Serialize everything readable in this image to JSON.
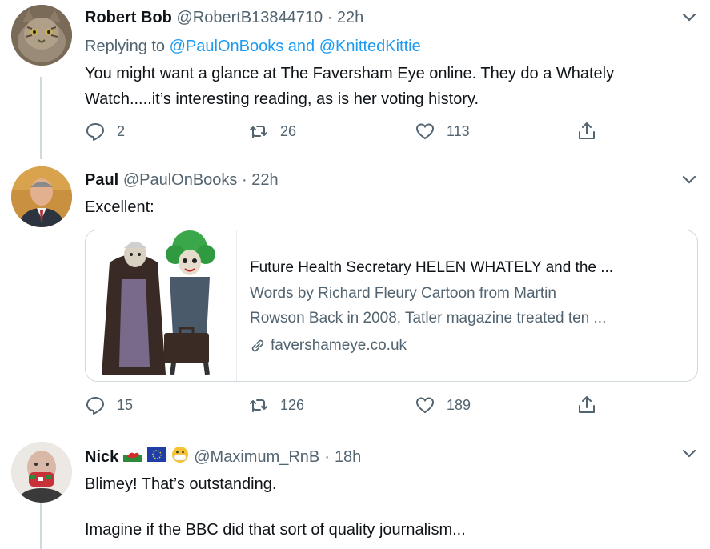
{
  "tweets": [
    {
      "name": "Robert Bob",
      "handle": "@RobertB13844710",
      "dot": "·",
      "time": "22h",
      "replying_prefix": "Replying to",
      "replying_to": "@PaulOnBooks and @KnittedKittie",
      "text_lines": [
        "You might want a glance at The Faversham Eye online. They do a Whately",
        "Watch.....it’s interesting reading, as is her voting history."
      ],
      "counts": {
        "replies": "2",
        "retweets": "26",
        "likes": "113"
      },
      "icons": {
        "reply": "reply-icon",
        "retweet": "retweet-icon",
        "like": "like-icon",
        "share": "share-icon",
        "more": "chevron-down-icon"
      }
    },
    {
      "name": "Paul",
      "handle": "@PaulOnBooks",
      "dot": "·",
      "time": "22h",
      "text_lines": [
        "Excellent:"
      ],
      "card": {
        "title": "Future Health Secretary HELEN WHATELY and the ...",
        "desc_lines": [
          "Words by Richard Fleury Cartoon from Martin",
          "Rowson Back in 2008, Tatler magazine treated ten ..."
        ],
        "domain": "favershameye.co.uk"
      },
      "counts": {
        "replies": "15",
        "retweets": "126",
        "likes": "189"
      }
    },
    {
      "name": "Nick",
      "handle": "@Maximum_RnB",
      "dot": "·",
      "time": "18h",
      "emojis": [
        "wales-flag-emoji",
        "eu-flag-emoji",
        "mask-face-emoji"
      ],
      "text_lines": [
        "Blimey! That’s outstanding.",
        "Imagine if the BBC did that sort of quality journalism..."
      ]
    }
  ]
}
